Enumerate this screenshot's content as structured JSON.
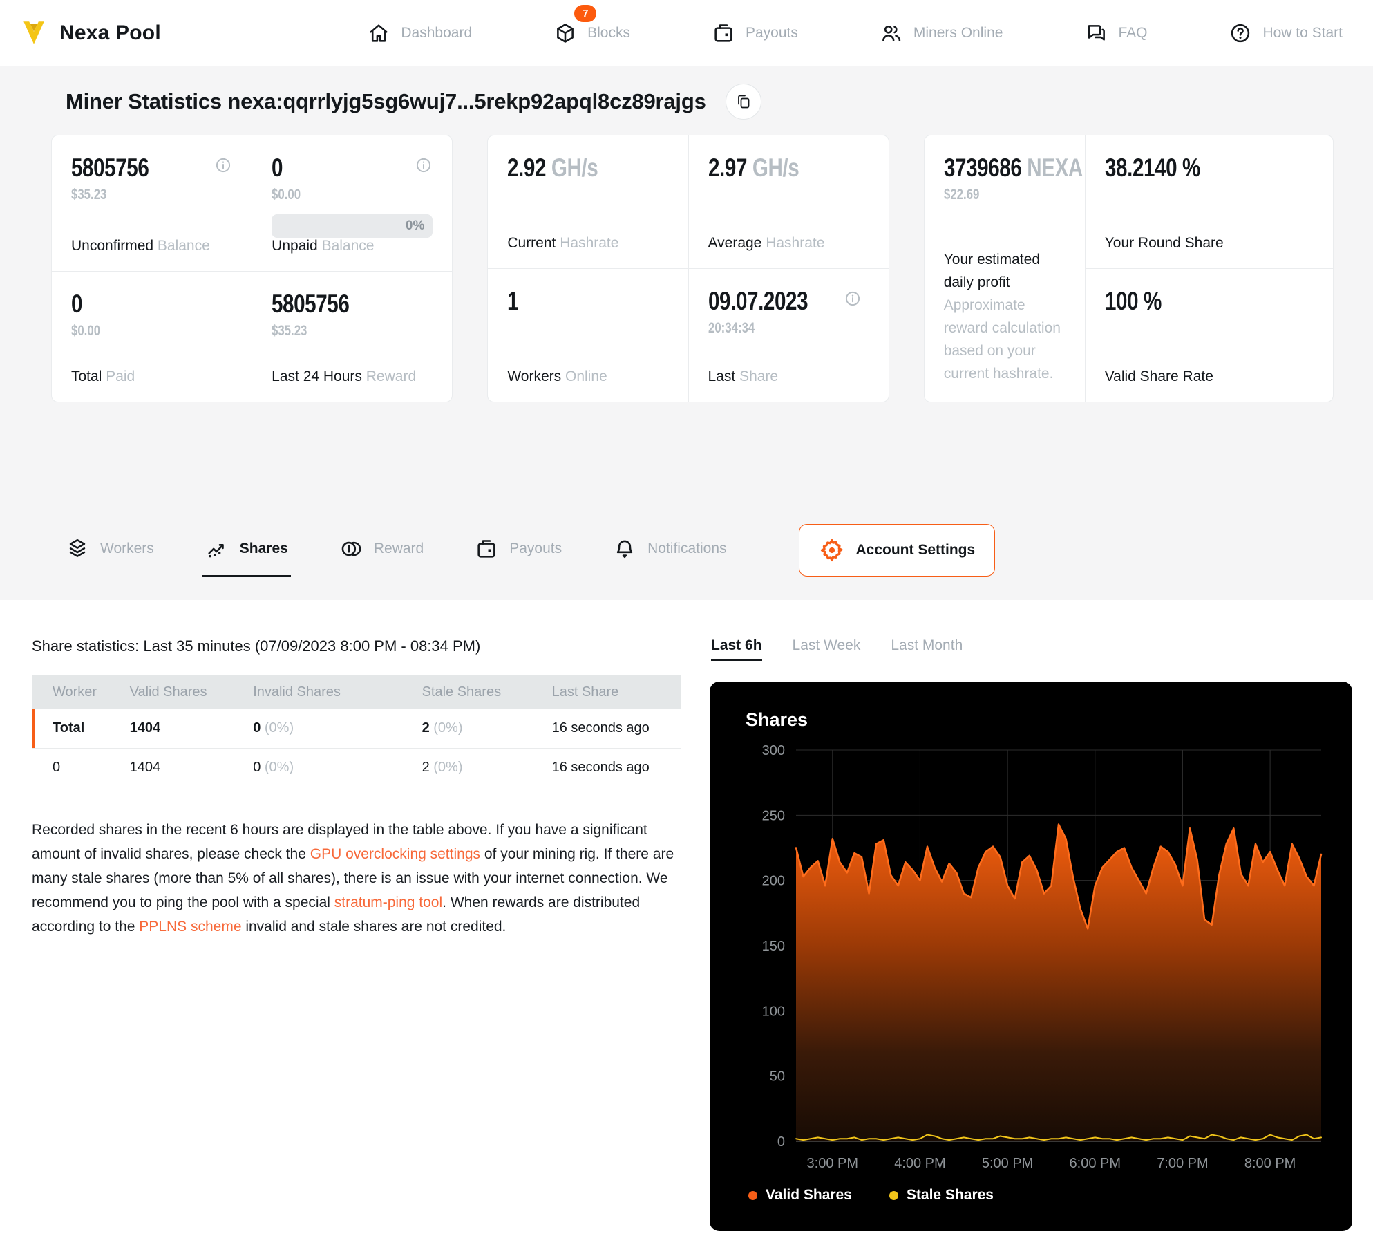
{
  "header": {
    "brand": "Nexa Pool",
    "nav": [
      {
        "label": "Dashboard"
      },
      {
        "label": "Blocks",
        "badge": "7"
      },
      {
        "label": "Payouts"
      },
      {
        "label": "Miners Online"
      },
      {
        "label": "FAQ"
      },
      {
        "label": "How to Start"
      }
    ]
  },
  "page": {
    "title": "Miner Statistics nexa:qqrrlyjg5sg6wuj7...5rekp92apql8cz89rajgs"
  },
  "colors": {
    "accent": "#f75e17",
    "link": "#f7693a",
    "badge": "#fc5a0d",
    "valid": "#f75e17",
    "stale": "#f2c51a"
  },
  "cards": {
    "unconfirmed": {
      "value": "5805756",
      "usd": "$35.23",
      "label_strong": "Unconfirmed",
      "label_muted": "Balance"
    },
    "unpaid": {
      "value": "0",
      "usd": "$0.00",
      "progress_label": "0%",
      "label_strong": "Unpaid",
      "label_muted": "Balance"
    },
    "total_paid": {
      "value": "0",
      "usd": "$0.00",
      "label_strong": "Total",
      "label_muted": "Paid"
    },
    "last_24h_reward": {
      "value": "5805756",
      "usd": "$35.23",
      "label_strong": "Last 24 Hours",
      "label_muted": "Reward"
    },
    "current_hashrate": {
      "value": "2.92",
      "unit": "GH/s",
      "label_strong": "Current",
      "label_muted": "Hashrate"
    },
    "average_hashrate": {
      "value": "2.97",
      "unit": "GH/s",
      "label_strong": "Average",
      "label_muted": "Hashrate"
    },
    "workers_online": {
      "value": "1",
      "label_strong": "Workers",
      "label_muted": "Online"
    },
    "last_share": {
      "value": "09.07.2023",
      "time": "20:34:34",
      "label_strong": "Last",
      "label_muted": "Share"
    },
    "round_share": {
      "value": "38.2140 %",
      "label": "Your Round Share"
    },
    "valid_share_rate": {
      "value": "100 %",
      "label": "Valid Share Rate"
    },
    "daily_profit": {
      "value": "3739686",
      "unit": "NEXA",
      "usd": "$22.69",
      "label": "Your estimated daily profit",
      "note": "Approximate reward calculation based on your current hashrate."
    }
  },
  "tabs": {
    "items": [
      {
        "label": "Workers"
      },
      {
        "label": "Shares"
      },
      {
        "label": "Reward"
      },
      {
        "label": "Payouts"
      },
      {
        "label": "Notifications"
      }
    ],
    "account_settings": "Account Settings"
  },
  "share_stats": {
    "heading": "Share statistics: Last 35 minutes (07/09/2023 8:00 PM - 08:34 PM)",
    "columns": [
      "Worker",
      "Valid Shares",
      "Invalid Shares",
      "Stale Shares",
      "Last Share"
    ],
    "rows": [
      {
        "worker": "Total",
        "valid": "1404",
        "invalid": "0",
        "invalid_pct": "(0%)",
        "stale": "2",
        "stale_pct": "(0%)",
        "last_share": "16 seconds ago"
      },
      {
        "worker": "0",
        "valid": "1404",
        "invalid": "0",
        "invalid_pct": "(0%)",
        "stale": "2",
        "stale_pct": "(0%)",
        "last_share": "16 seconds ago"
      }
    ],
    "note_parts": [
      {
        "t": "Recorded shares in the recent 6 hours are displayed in the table above. If you have a significant amount of invalid shares, please check the "
      },
      {
        "t": "GPU overclocking settings",
        "link": true
      },
      {
        "t": " of your mining rig. If there are many stale shares (more than 5% of all shares), there is an issue with your internet connection. We recommend you to ping the pool with a special "
      },
      {
        "t": "stratum-ping tool",
        "link": true
      },
      {
        "t": ". When rewards are distributed according to the "
      },
      {
        "t": "PPLNS scheme",
        "link": true
      },
      {
        "t": " invalid and stale shares are not credited."
      }
    ]
  },
  "chart_tabs": [
    {
      "label": "Last 6h",
      "active": true
    },
    {
      "label": "Last Week"
    },
    {
      "label": "Last Month"
    }
  ],
  "chart_data": {
    "type": "area",
    "title": "Shares",
    "x_range": [
      "2:35 PM",
      "8:35 PM"
    ],
    "x_interval_minutes": 5,
    "ylim": [
      0,
      300
    ],
    "yticks": [
      0,
      50,
      100,
      150,
      200,
      250,
      300
    ],
    "xticks": [
      {
        "i": 5,
        "label": "3:00 PM"
      },
      {
        "i": 17,
        "label": "4:00 PM"
      },
      {
        "i": 29,
        "label": "5:00 PM"
      },
      {
        "i": 41,
        "label": "6:00 PM"
      },
      {
        "i": 53,
        "label": "7:00 PM"
      },
      {
        "i": 65,
        "label": "8:00 PM"
      }
    ],
    "grid": true,
    "legend_position": "bottom",
    "background": "#000000",
    "series": [
      {
        "name": "Valid Shares",
        "color": "#f75e17",
        "values": [
          225,
          203,
          210,
          215,
          196,
          232,
          214,
          206,
          221,
          218,
          190,
          228,
          231,
          204,
          196,
          214,
          208,
          200,
          226,
          210,
          199,
          213,
          206,
          190,
          187,
          210,
          222,
          226,
          218,
          196,
          186,
          214,
          219,
          208,
          190,
          196,
          243,
          232,
          202,
          178,
          163,
          196,
          210,
          216,
          222,
          225,
          210,
          200,
          190,
          210,
          226,
          222,
          212,
          196,
          240,
          216,
          170,
          166,
          204,
          228,
          240,
          205,
          196,
          228,
          214,
          222,
          208,
          196,
          228,
          217,
          203,
          196,
          220
        ]
      },
      {
        "name": "Stale Shares",
        "color": "#f2c51a",
        "values": [
          2,
          1,
          2,
          3,
          2,
          1,
          2,
          2,
          3,
          1,
          2,
          2,
          1,
          2,
          3,
          2,
          1,
          2,
          5,
          4,
          2,
          1,
          2,
          3,
          2,
          1,
          2,
          2,
          4,
          3,
          2,
          2,
          3,
          2,
          1,
          2,
          2,
          3,
          2,
          1,
          2,
          3,
          2,
          2,
          1,
          2,
          3,
          2,
          1,
          2,
          2,
          3,
          2,
          1,
          4,
          3,
          2,
          5,
          4,
          2,
          1,
          3,
          2,
          1,
          2,
          5,
          3,
          2,
          1,
          4,
          5,
          2,
          3
        ]
      }
    ]
  }
}
